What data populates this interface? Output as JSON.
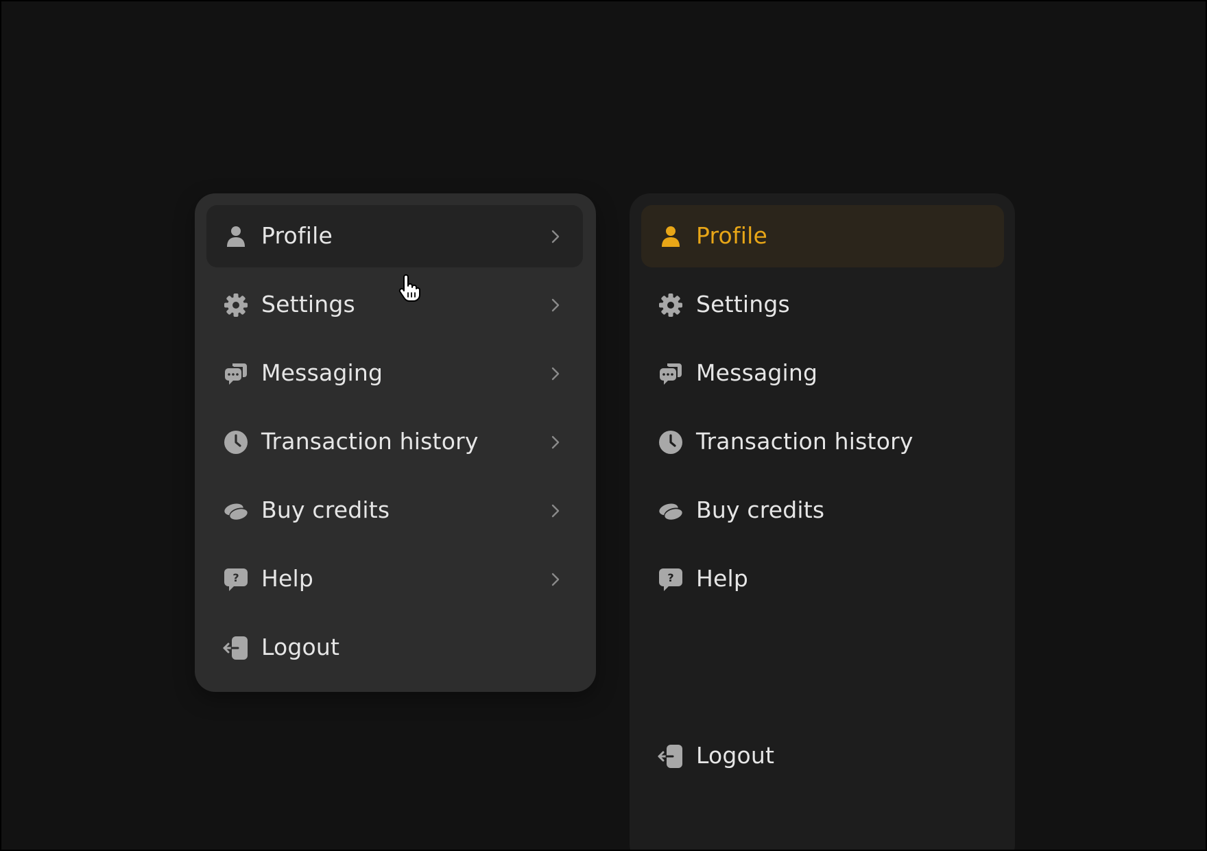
{
  "colors": {
    "background": "#121212",
    "dropdown_bg": "#2d2d2d",
    "hover_row_bg": "#232323",
    "sidebar_bg": "#1d1d1d",
    "active_row_bg": "#2b251b",
    "accent": "#e8a617",
    "text": "#e6e6e6",
    "icon": "#a8a8a8"
  },
  "dropdown_menu": {
    "items": [
      {
        "label": "Profile",
        "icon": "user-icon",
        "state": "hover",
        "has_chevron": true
      },
      {
        "label": "Settings",
        "icon": "gear-icon",
        "has_chevron": true
      },
      {
        "label": "Messaging",
        "icon": "chat-bubbles-icon",
        "has_chevron": true
      },
      {
        "label": "Transaction history",
        "icon": "clock-icon",
        "has_chevron": true
      },
      {
        "label": "Buy credits",
        "icon": "coins-icon",
        "has_chevron": true
      },
      {
        "label": "Help",
        "icon": "help-bubble-icon",
        "has_chevron": true
      },
      {
        "label": "Logout",
        "icon": "logout-icon",
        "has_chevron": false
      }
    ]
  },
  "sidebar": {
    "items": [
      {
        "label": "Profile",
        "icon": "user-icon",
        "state": "active"
      },
      {
        "label": "Settings",
        "icon": "gear-icon"
      },
      {
        "label": "Messaging",
        "icon": "chat-bubbles-icon"
      },
      {
        "label": "Transaction history",
        "icon": "clock-icon"
      },
      {
        "label": "Buy credits",
        "icon": "coins-icon"
      },
      {
        "label": "Help",
        "icon": "help-bubble-icon"
      },
      {
        "label": "Logout",
        "icon": "logout-icon"
      }
    ]
  }
}
